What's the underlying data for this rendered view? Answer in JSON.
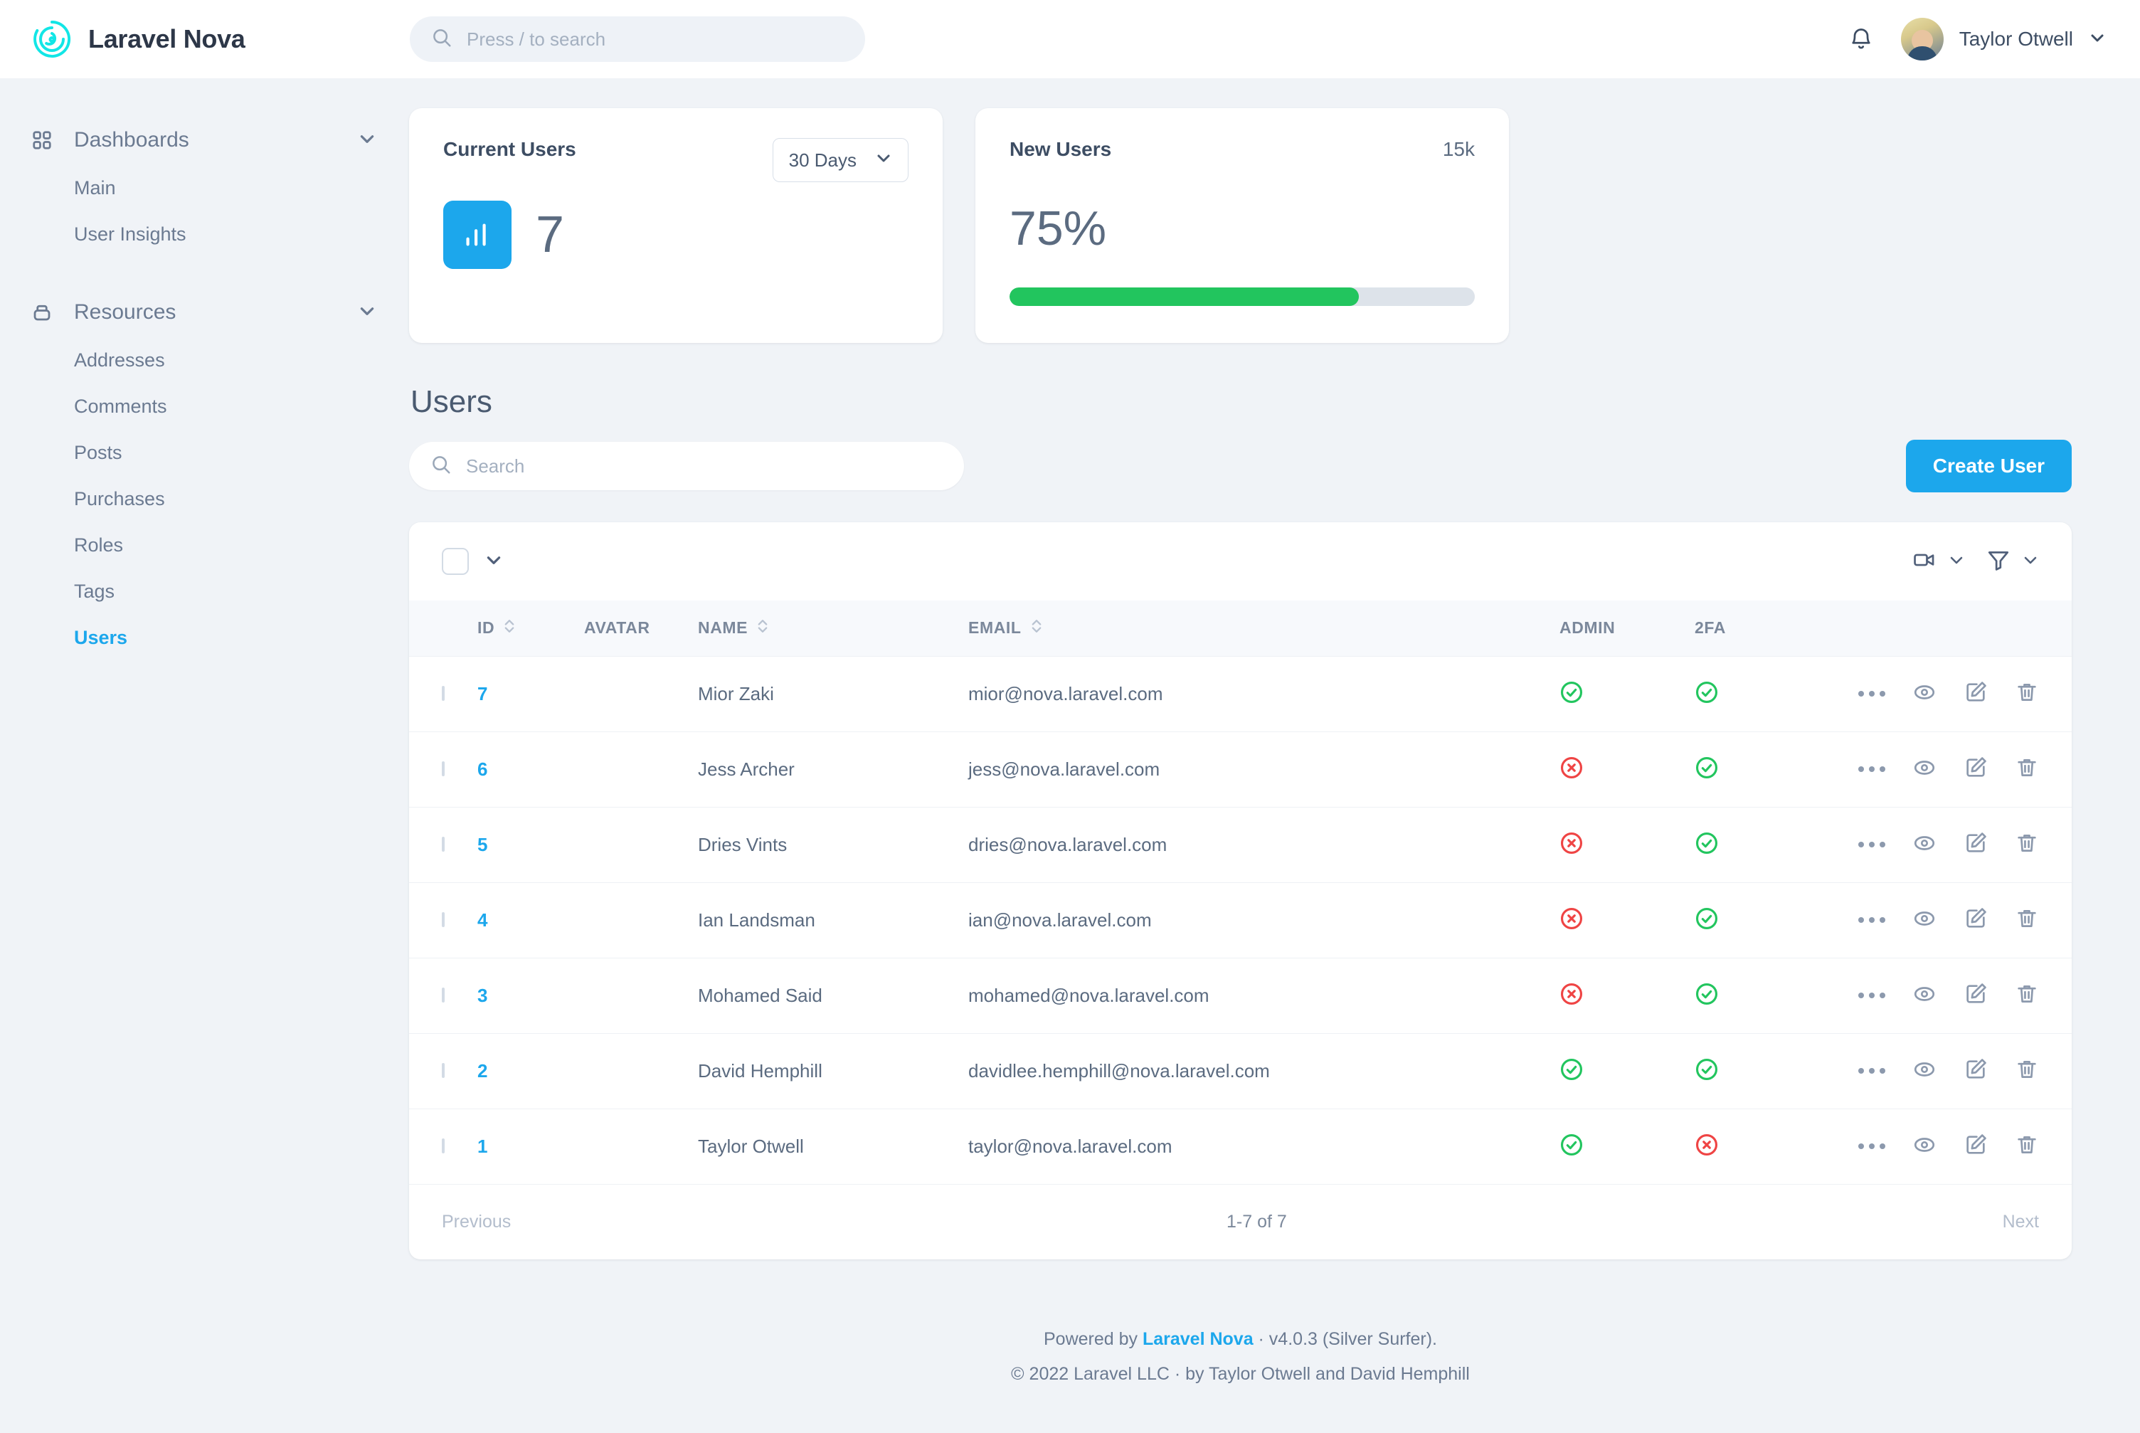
{
  "brand": {
    "name": "Laravel Nova",
    "logo_icon": "nova-spiral-logo"
  },
  "global_search": {
    "placeholder": "Press / to search",
    "icon": "search-icon",
    "value": ""
  },
  "topbar": {
    "notifications_icon": "bell-icon",
    "user": {
      "name": "Taylor Otwell",
      "avatar": "user-avatar",
      "caret": "chevron-down-icon"
    }
  },
  "sidebar": {
    "groups": [
      {
        "label": "Dashboards",
        "icon": "grid-icon",
        "chevron": "chevron-down-icon",
        "items": [
          {
            "label": "Main",
            "active": false
          },
          {
            "label": "User Insights",
            "active": false
          }
        ]
      },
      {
        "label": "Resources",
        "icon": "drawer-icon",
        "chevron": "chevron-down-icon",
        "items": [
          {
            "label": "Addresses",
            "active": false
          },
          {
            "label": "Comments",
            "active": false
          },
          {
            "label": "Posts",
            "active": false
          },
          {
            "label": "Purchases",
            "active": false
          },
          {
            "label": "Roles",
            "active": false
          },
          {
            "label": "Tags",
            "active": false
          },
          {
            "label": "Users",
            "active": true
          }
        ]
      }
    ]
  },
  "metrics": [
    {
      "title": "Current Users",
      "range": "30 Days",
      "range_caret": "chevron-down-icon",
      "icon": "bar-chart-icon",
      "value": "7"
    },
    {
      "title": "New Users",
      "total": "15k",
      "value": "75%",
      "progress_percent": 75,
      "progress_color": "#22c55e"
    }
  ],
  "users_section": {
    "title": "Users",
    "search": {
      "placeholder": "Search",
      "value": "",
      "icon": "search-icon"
    },
    "create_button": "Create User"
  },
  "table": {
    "toolbar": {
      "select_all_checkbox": "select-all-checkbox",
      "select_all_caret": "chevron-down-icon",
      "preview_icon": "video-camera-icon",
      "preview_caret": "chevron-down-icon",
      "filter_icon": "filter-funnel-icon",
      "filter_caret": "chevron-down-icon"
    },
    "columns": [
      {
        "key": "id",
        "label": "ID",
        "sortable": true
      },
      {
        "key": "avatar",
        "label": "AVATAR",
        "sortable": false
      },
      {
        "key": "name",
        "label": "NAME",
        "sortable": true
      },
      {
        "key": "email",
        "label": "EMAIL",
        "sortable": true
      },
      {
        "key": "admin",
        "label": "ADMIN",
        "sortable": false
      },
      {
        "key": "twofa",
        "label": "2FA",
        "sortable": false
      }
    ],
    "rows": [
      {
        "id": "7",
        "name": "Mior Zaki",
        "email": "mior@nova.laravel.com",
        "admin": "yes",
        "twofa": "yes",
        "avatar_colors": [
          "#d9c98a",
          "#8aa37b"
        ]
      },
      {
        "id": "6",
        "name": "Jess Archer",
        "email": "jess@nova.laravel.com",
        "admin": "no",
        "twofa": "yes",
        "avatar_colors": [
          "#1a1a1a",
          "#333333"
        ]
      },
      {
        "id": "5",
        "name": "Dries Vints",
        "email": "dries@nova.laravel.com",
        "admin": "no",
        "twofa": "yes",
        "avatar_colors": [
          "#3c3733",
          "#6b5f55"
        ]
      },
      {
        "id": "4",
        "name": "Ian Landsman",
        "email": "ian@nova.laravel.com",
        "admin": "no",
        "twofa": "yes",
        "avatar_colors": [
          "#cf9f77",
          "#4f8fc0"
        ]
      },
      {
        "id": "3",
        "name": "Mohamed Said",
        "email": "mohamed@nova.laravel.com",
        "admin": "no",
        "twofa": "yes",
        "avatar_colors": [
          "#e8e8e8",
          "#bdbdbd"
        ]
      },
      {
        "id": "2",
        "name": "David Hemphill",
        "email": "davidlee.hemphill@nova.laravel.com",
        "admin": "yes",
        "twofa": "yes",
        "avatar_colors": [
          "#2fd98a",
          "#7b5cc7"
        ]
      },
      {
        "id": "1",
        "name": "Taylor Otwell",
        "email": "taylor@nova.laravel.com",
        "admin": "yes",
        "twofa": "no",
        "avatar_colors": [
          "#ede3b0",
          "#4a6c8f"
        ]
      }
    ],
    "row_actions": {
      "more_icon": "ellipsis-icon",
      "view_icon": "eye-icon",
      "edit_icon": "pencil-square-icon",
      "delete_icon": "trash-icon"
    },
    "pagination": {
      "previous": "Previous",
      "info": "1-7 of 7",
      "next": "Next"
    }
  },
  "footer": {
    "powered_prefix": "Powered by ",
    "powered_link": "Laravel Nova",
    "powered_suffix": " · v4.0.3 (Silver Surfer).",
    "copyright": "© 2022 Laravel LLC · by Taylor Otwell and David Hemphill"
  },
  "colors": {
    "accent": "#1ca7ec",
    "success": "#22c55e",
    "danger": "#ef4444",
    "page_bg": "#f0f3f7"
  }
}
